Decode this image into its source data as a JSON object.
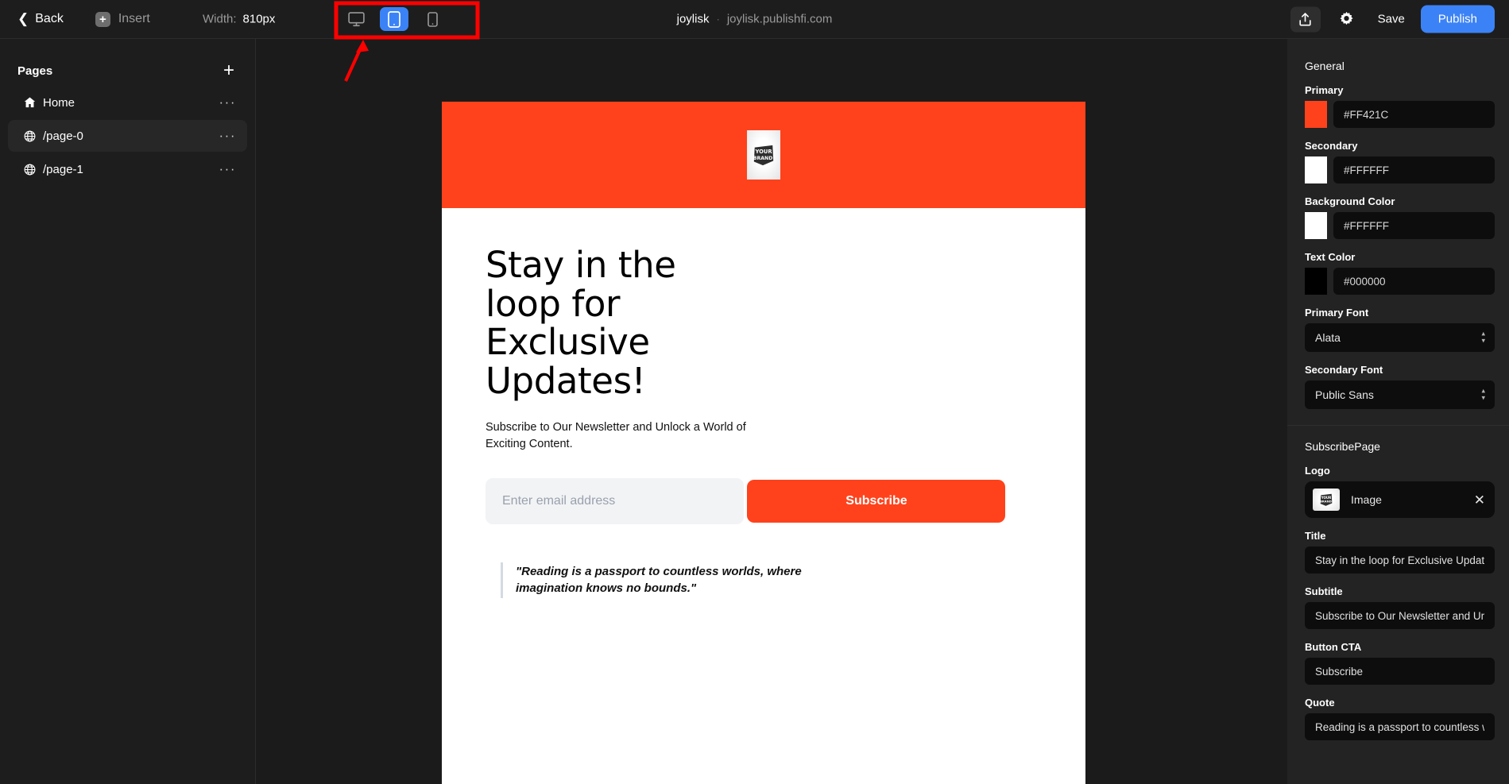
{
  "topbar": {
    "back_label": "Back",
    "insert_label": "Insert",
    "width_label": "Width:",
    "width_value": "810px",
    "devices": [
      {
        "name": "desktop",
        "active": false
      },
      {
        "name": "tablet",
        "active": true
      },
      {
        "name": "mobile",
        "active": false
      }
    ],
    "site_name": "joylisk",
    "separator": "·",
    "site_url": "joylisk.publishfi.com",
    "save_label": "Save",
    "publish_label": "Publish"
  },
  "sidebar": {
    "title": "Pages",
    "add_label": "+",
    "items": [
      {
        "label": "Home",
        "icon": "home-icon",
        "selected": false
      },
      {
        "label": "/page-0",
        "icon": "globe-icon",
        "selected": true
      },
      {
        "label": "/page-1",
        "icon": "globe-icon",
        "selected": false
      }
    ],
    "row_menu": "···"
  },
  "canvas": {
    "logo_alt": "YOUR BRAND",
    "title": "Stay in the loop for Exclusive Updates!",
    "subtitle": "Subscribe to Our Newsletter and Unlock a World of Exciting Content.",
    "email_placeholder": "Enter email address",
    "email_value": "",
    "cta_label": "Subscribe",
    "quote": "\"Reading is a passport to countless worlds, where imagination knows no bounds.\"",
    "hero_bg": "#FF421C",
    "cta_bg": "#FF421C"
  },
  "right_panel": {
    "general_title": "General",
    "colors": [
      {
        "label": "Primary",
        "value": "#FF421C",
        "swatch": "#FF421C"
      },
      {
        "label": "Secondary",
        "value": "#FFFFFF",
        "swatch": "#FFFFFF"
      },
      {
        "label": "Background Color",
        "value": "#FFFFFF",
        "swatch": "#FFFFFF"
      },
      {
        "label": "Text Color",
        "value": "#000000",
        "swatch": "#000000"
      }
    ],
    "primary_font_label": "Primary Font",
    "primary_font_value": "Alata",
    "secondary_font_label": "Secondary Font",
    "secondary_font_value": "Public Sans",
    "section_title": "SubscribePage",
    "logo_label": "Logo",
    "logo_value": "Image",
    "logo_remove": "✕",
    "title_label": "Title",
    "title_value": "Stay in the loop for Exclusive Updates!",
    "subtitle_label": "Subtitle",
    "subtitle_value": "Subscribe to Our Newsletter and Unlock a World of Exciting Content.",
    "cta_label_text": "Button CTA",
    "cta_value": "Subscribe",
    "quote_label": "Quote",
    "quote_value": "Reading is a passport to countless worlds, where imagination knows no bounds."
  },
  "annotation": {
    "highlight_color": "#FF0000",
    "target": "device-toggle-group"
  }
}
